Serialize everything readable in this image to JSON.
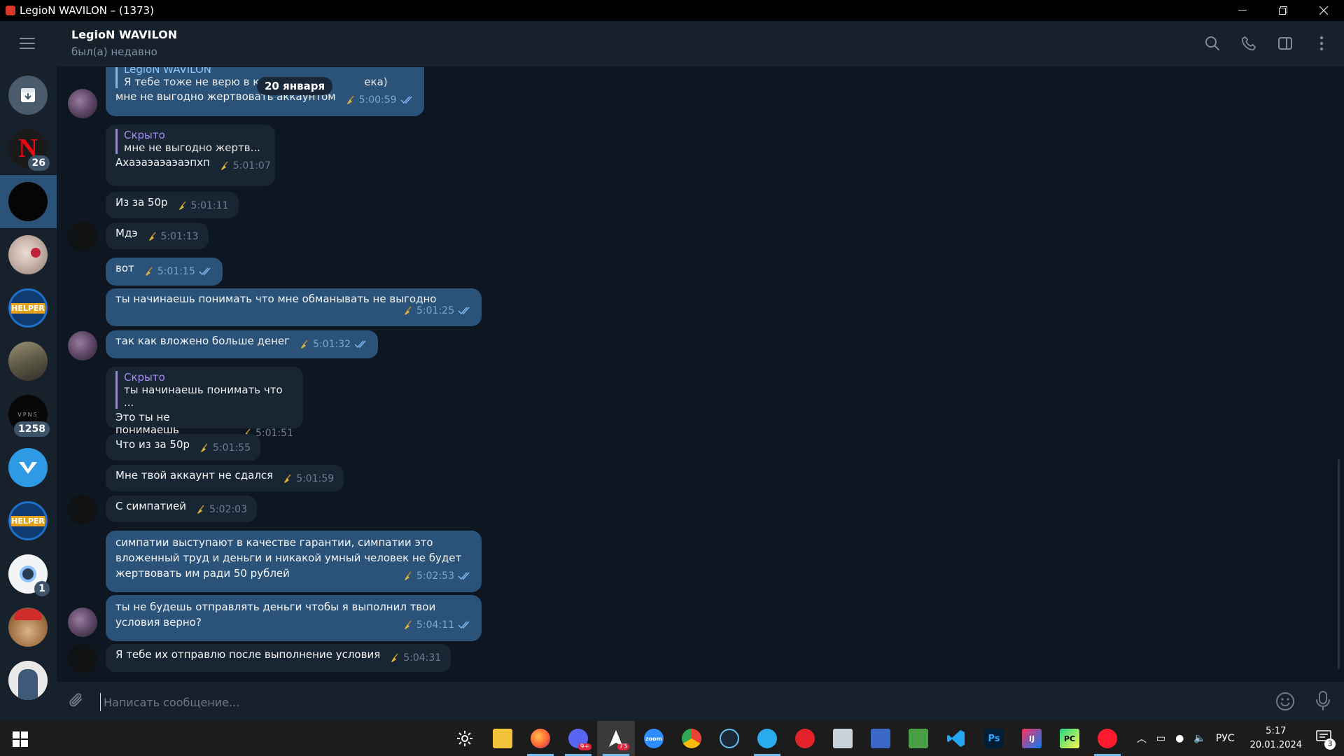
{
  "window": {
    "title": "LegioN WAVILON – (1373)"
  },
  "header": {
    "name": "LegioN WAVILON",
    "status": "был(а) недавно"
  },
  "date_pill": "20 января",
  "sidebar": {
    "chats": [
      {
        "name": "archive",
        "badge": ""
      },
      {
        "name": "chat-netflix",
        "badge": "26"
      },
      {
        "name": "chat-dark",
        "badge": ""
      },
      {
        "name": "chat-cat",
        "badge": ""
      },
      {
        "name": "chat-helper",
        "badge": ""
      },
      {
        "name": "chat-soldiers",
        "badge": ""
      },
      {
        "name": "chat-vpns",
        "badge": "1258"
      },
      {
        "name": "chat-vk",
        "badge": ""
      },
      {
        "name": "chat-helper-2",
        "badge": ""
      },
      {
        "name": "chat-bot",
        "badge": "1"
      },
      {
        "name": "chat-monkey",
        "badge": ""
      },
      {
        "name": "chat-figure",
        "badge": ""
      }
    ]
  },
  "messages": [
    {
      "reply_name": "LegioN WAVILON",
      "reply_text": "Я тебе тоже не верю в к",
      "reply_text_end": "ека)",
      "text": "мне не выгодно жертвовать аккаунтом",
      "time": "5:00:59",
      "out": true
    },
    {
      "reply_name": "Скрыто",
      "reply_text": "мне не выгодно жертв...",
      "text": "Ахаэаэаэаэаэпхп",
      "time": "5:01:07",
      "out": false
    },
    {
      "text": "Из за 50р",
      "time": "5:01:11",
      "out": false
    },
    {
      "text": "Мдэ",
      "time": "5:01:13",
      "out": false
    },
    {
      "text": "вот",
      "time": "5:01:15",
      "out": true
    },
    {
      "text": "ты начинаешь понимать что мне обманывать не выгодно",
      "time": "5:01:25",
      "out": true
    },
    {
      "text": "так как вложено больше денег",
      "time": "5:01:32",
      "out": true
    },
    {
      "reply_name": "Скрыто",
      "reply_text": "ты начинаешь понимать что ...",
      "text": "Это ты не понимаешь",
      "time": "5:01:51",
      "out": false
    },
    {
      "text": "Что из за 50р",
      "time": "5:01:55",
      "out": false
    },
    {
      "text": "Мне твой аккаунт не сдался",
      "time": "5:01:59",
      "out": false
    },
    {
      "text": "С симпатией",
      "time": "5:02:03",
      "out": false
    },
    {
      "text_l1": "симпатии выступают в качестве гарантии, симпатии это",
      "text_l2": "вложенный труд и деньги и никакой умный человек не будет",
      "text_l3": "жертвовать им ради 50 рублей",
      "time": "5:02:53",
      "out": true
    },
    {
      "text_l1": "ты не будешь отправлять деньги чтобы я выполнил твои",
      "text_l2": "условия верно?",
      "time": "5:04:11",
      "out": true
    },
    {
      "text": "Я тебе их отправлю после выполнение условия",
      "time": "5:04:31",
      "out": false
    }
  ],
  "input": {
    "placeholder": "Написать сообщение..."
  },
  "taskbar": {
    "apps": [
      "settings",
      "explorer",
      "firefox",
      "discord",
      "nav",
      "zoom",
      "chrome",
      "steam",
      "telegram",
      "adobe",
      "monitor",
      "network",
      "translate",
      "vscode",
      "photoshop",
      "intellij",
      "pycharm",
      "opera"
    ],
    "discord_badge": "9+",
    "nav_badge": "73",
    "lang": "РУС",
    "time": "5:17",
    "date": "20.01.2024",
    "notifications": "3"
  },
  "colors": {
    "bg": "#0e1621",
    "panel": "#17212b",
    "outgoing": "#2b5278",
    "incoming": "#182533",
    "accent": "#5fa8e8"
  }
}
